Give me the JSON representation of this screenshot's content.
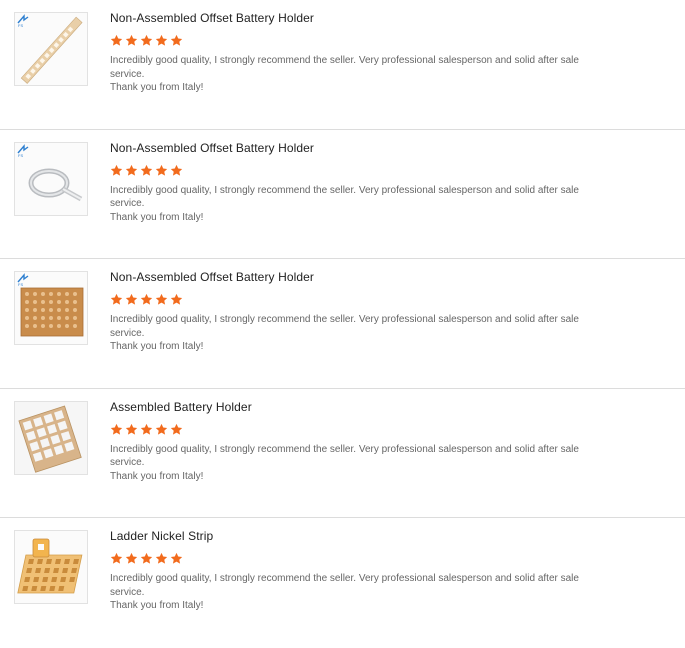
{
  "reviews": [
    {
      "title": "Non-Assembled Offset Battery Holder",
      "rating": 5,
      "text_line1": "Incredibly good quality, I strongly recommend the seller. Very professional salesperson and solid after sale service.",
      "text_line2": "Thank you from Italy!",
      "thumbnail": "diagonal-nickel-strip-image"
    },
    {
      "title": "Non-Assembled Offset Battery Holder",
      "rating": 5,
      "text_line1": "Incredibly good quality, I strongly recommend the seller. Very professional salesperson and solid after sale service.",
      "text_line2": "Thank you from Italy!",
      "thumbnail": "nickel-strip-roll-image"
    },
    {
      "title": "Non-Assembled Offset Battery Holder",
      "rating": 5,
      "text_line1": "Incredibly good quality, I strongly recommend the seller. Very professional salesperson and solid after sale service.",
      "text_line2": "Thank you from Italy!",
      "thumbnail": "copper-sheet-grid-image"
    },
    {
      "title": "Assembled Battery Holder",
      "rating": 5,
      "text_line1": "Incredibly good quality, I strongly recommend the seller. Very professional salesperson and solid after sale service.",
      "text_line2": "Thank you from Italy!",
      "thumbnail": "assembled-holder-grid-image"
    },
    {
      "title": "Ladder Nickel Strip",
      "rating": 5,
      "text_line1": "Incredibly good quality, I strongly recommend the seller. Very professional salesperson and solid after sale service.",
      "text_line2": "Thank you from Italy!",
      "thumbnail": "ladder-nickel-strip-image"
    }
  ],
  "colors": {
    "star": "#f26b1d",
    "divider": "#dcdcdc",
    "title": "#222222",
    "text": "#666666"
  }
}
